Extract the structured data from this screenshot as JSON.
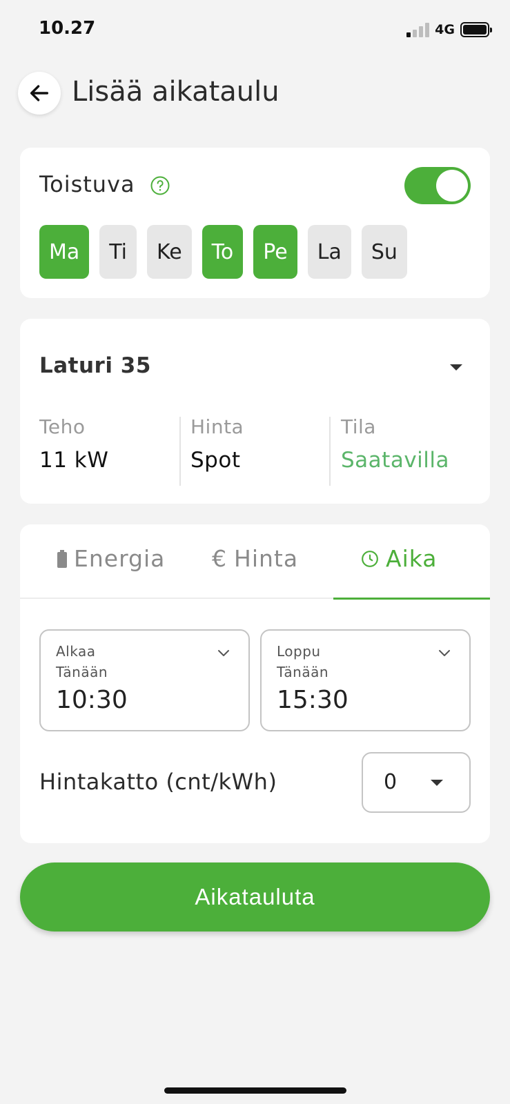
{
  "status_bar": {
    "time": "10.27",
    "network": "4G"
  },
  "header": {
    "title": "Lisää aikataulu",
    "back_icon": "arrow-left-icon"
  },
  "recurrence": {
    "label": "Toistuva",
    "help_icon": "question-circle-icon",
    "enabled": true,
    "days": [
      {
        "label": "Ma",
        "selected": true
      },
      {
        "label": "Ti",
        "selected": false
      },
      {
        "label": "Ke",
        "selected": false
      },
      {
        "label": "To",
        "selected": true
      },
      {
        "label": "Pe",
        "selected": true
      },
      {
        "label": "La",
        "selected": false
      },
      {
        "label": "Su",
        "selected": false
      }
    ]
  },
  "charger": {
    "name": "Laturi 35",
    "stats": [
      {
        "label": "Teho",
        "value": "11 kW"
      },
      {
        "label": "Hinta",
        "value": "Spot"
      },
      {
        "label": "Tila",
        "value": "Saatavilla"
      }
    ]
  },
  "mode_tabs": [
    {
      "label": "Energia",
      "icon": "battery-icon",
      "active": false
    },
    {
      "label": "Hinta",
      "icon": "euro-icon",
      "active": false
    },
    {
      "label": "Aika",
      "icon": "clock-icon",
      "active": true
    }
  ],
  "schedule": {
    "start": {
      "label": "Alkaa",
      "day": "Tänään",
      "time": "10:30"
    },
    "end": {
      "label": "Loppu",
      "day": "Tänään",
      "time": "15:30"
    }
  },
  "price_cap": {
    "label": "Hintakatto (cnt/kWh)",
    "value": "0"
  },
  "submit_label": "Aikatauluta",
  "colors": {
    "accent": "#4caf3a",
    "available": "#5bb56a",
    "background": "#f3f3f3"
  }
}
